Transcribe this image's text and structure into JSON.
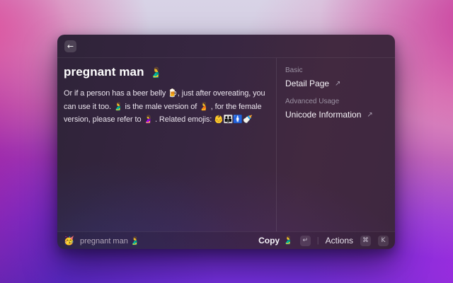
{
  "window": {
    "header": {
      "back_icon": "←"
    },
    "main": {
      "title": "pregnant man",
      "title_emoji": "🫃",
      "description": "Or if a person has a beer belly 🍺, just after overeating, you can use it too. 🫃 is the male version of 🫄 , for the female version, please refer to 🤰 . Related emojis: 👶👪🚺🍼"
    },
    "sidebar": {
      "sections": [
        {
          "label": "Basic",
          "link": "Detail Page",
          "link_icon": "↗"
        },
        {
          "label": "Advanced Usage",
          "link": "Unicode Information",
          "link_icon": "↗"
        }
      ]
    },
    "footer": {
      "app_icon": "🥳",
      "context_label": "pregnant man 🫃",
      "separator": "|",
      "copy": {
        "label": "Copy",
        "emoji": "🫃",
        "key": "↵"
      },
      "actions": {
        "label": "Actions",
        "keys": [
          "⌘",
          "K"
        ]
      }
    }
  },
  "colors": {
    "accent_pink": "#e0559e",
    "accent_violet": "#7a2ee2",
    "window_bg": "#38263e",
    "text_primary": "#ffffff",
    "text_secondary": "#b3a8ba",
    "text_label": "#9b91a2"
  }
}
